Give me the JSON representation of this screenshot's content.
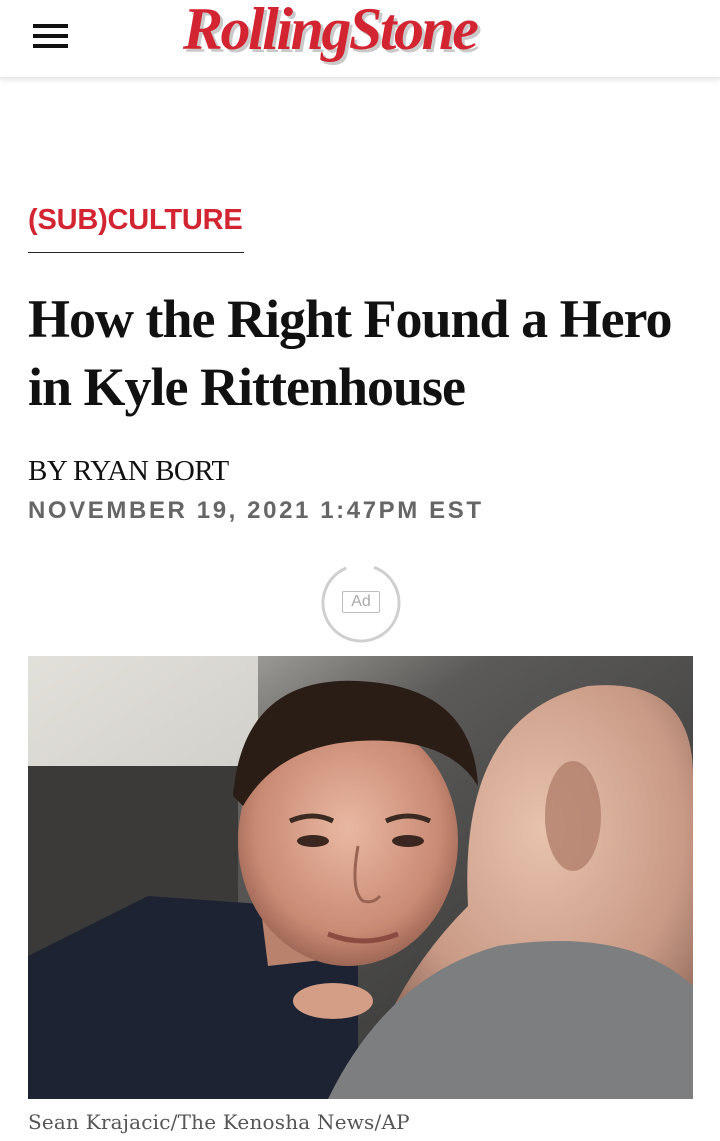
{
  "header": {
    "logo_text": "RollingStone",
    "brand_color": "#d32531"
  },
  "article": {
    "section": "(SUB)CULTURE",
    "headline": "How the Right Found a Hero in Kyle Rittenhouse",
    "byline": "BY RYAN BORT",
    "date": "NOVEMBER 19, 2021 1:47PM EST",
    "ad_label": "Ad",
    "photo_caption": "Sean Krajacic/The Kenosha News/AP"
  },
  "icons": {
    "menu": "hamburger-menu-icon"
  }
}
